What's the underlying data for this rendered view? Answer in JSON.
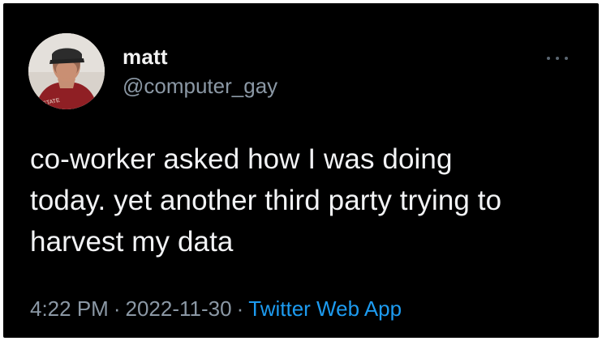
{
  "tweet": {
    "author": {
      "display_name": "matt",
      "handle": "@computer_gay",
      "avatar_icon": "profile-photo-icon"
    },
    "body_lines": [
      "co-worker asked how I was doing",
      "today. yet another third party trying to",
      "harvest my data"
    ],
    "meta": {
      "time": "4:22 PM",
      "date": "2022-11-30",
      "separator": "·",
      "source": "Twitter Web App"
    },
    "more_icon": "more-horizontal-icon"
  },
  "colors": {
    "background": "#000000",
    "text": "#e7e9ea",
    "muted": "#8b98a5",
    "link": "#1d9bf0"
  }
}
